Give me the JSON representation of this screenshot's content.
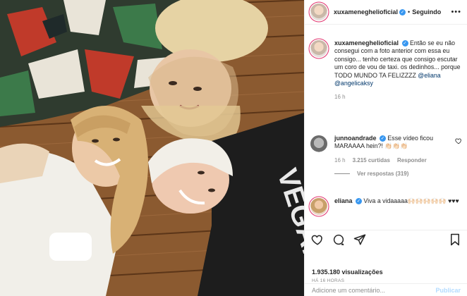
{
  "header": {
    "username": "xuxameneghelioficial",
    "separator": "•",
    "follow_label": "Seguindo",
    "more_label": "•••"
  },
  "caption": {
    "username": "xuxameneghelioficial",
    "text": "Então se eu não consegui com a foto anterior com essa eu consigo... tenho certeza que consigo escutar um coro de vou de taxi. os dedinhos... porque TODO MUNDO TA FELIZZZZ",
    "mention1": "@eliana",
    "mention2": "@angelicaksy",
    "time": "16 h"
  },
  "comments": [
    {
      "username": "junnoandrade",
      "text": "Esse vídeo ficou MARAAAA hein?! 👏🏻👏🏻👏🏻",
      "time": "16 h",
      "likes": "3.215 curtidas",
      "reply": "Responder",
      "view_replies": "Ver respostas (319)"
    },
    {
      "username": "eliana",
      "text": "Viva a vidaaaaa🙌🏻🙌🏻🙌🏻🙌🏻🙌🏻 ♥♥♥"
    }
  ],
  "stats": {
    "views": "1.935.180 visualizações",
    "ago": "HÁ 16 HORAS"
  },
  "comment_box": {
    "placeholder": "Adicione um comentário...",
    "publish": "Publicar"
  },
  "shirt_text": "VEGAN",
  "colors": {
    "verified": "#3897f0",
    "link": "#00376b",
    "muted": "#8e8e8e",
    "publish_disabled": "#b3dbff"
  }
}
